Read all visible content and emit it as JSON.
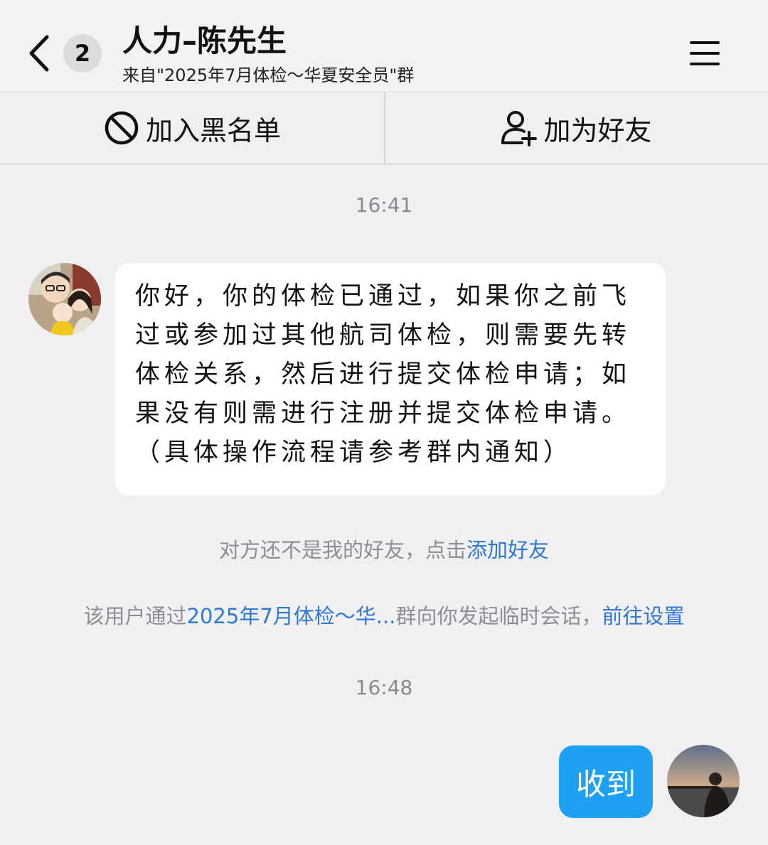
{
  "header": {
    "unread_count": "2",
    "title": "人力–陈先生",
    "subtitle": "来自\"2025年7月体检～华夏安全员\"群"
  },
  "actions": {
    "blacklist_label": "加入黑名单",
    "add_friend_label": "加为好友"
  },
  "messages": {
    "time1": "16:41",
    "incoming_text": "你好，你的体检已通过，如果你之前飞过或参加过其他航司体检，则需要先转体检关系，然后进行提交体检申请；如果没有则需进行注册并提交体检申请。（具体操作流程请参考群内通知）",
    "time2": "16:48",
    "outgoing_text": "收到"
  },
  "notices": {
    "not_friend_prefix": "对方还不是我的好友，点击",
    "add_friend_link": "添加好友",
    "temp_prefix": "该用户通过",
    "group_link": "2025年7月体检～华...",
    "temp_middle": "群向你发起临时会话，",
    "settings_link": "前往设置"
  },
  "icons": {
    "back": "chevron-left-icon",
    "menu": "hamburger-menu-icon",
    "blacklist": "block-icon",
    "add_friend": "add-user-icon"
  },
  "colors": {
    "link": "#2f78d6",
    "outgoing_bubble": "#1ea1f5",
    "background": "#f0f0f2"
  }
}
